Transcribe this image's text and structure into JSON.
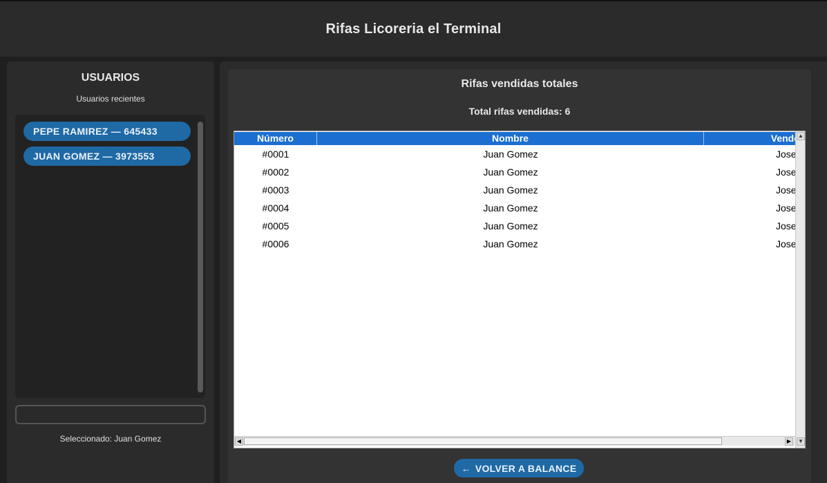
{
  "app": {
    "title": "Rifas Licoreria el Terminal"
  },
  "sidebar": {
    "title": "USUARIOS",
    "subtitle": "Usuarios recientes",
    "users": [
      {
        "name": "PEPE RAMIREZ",
        "id": "645433",
        "label": "PEPE RAMIREZ  —  645433"
      },
      {
        "name": "JUAN GOMEZ",
        "id": "3973553",
        "label": "JUAN GOMEZ  —  3973553"
      }
    ],
    "search_value": "",
    "selected_text": "Seleccionado: Juan Gomez"
  },
  "main": {
    "title": "Rifas vendidas totales",
    "total_text": "Total rifas vendidas: 6",
    "table": {
      "columns": [
        "Número",
        "Nombre",
        "Vende"
      ],
      "rows": [
        [
          "#0001",
          "Juan Gomez",
          "Jose"
        ],
        [
          "#0002",
          "Juan Gomez",
          "Jose"
        ],
        [
          "#0003",
          "Juan Gomez",
          "Jose"
        ],
        [
          "#0004",
          "Juan Gomez",
          "Jose"
        ],
        [
          "#0005",
          "Juan Gomez",
          "Jose"
        ],
        [
          "#0006",
          "Juan Gomez",
          "Jose"
        ]
      ]
    },
    "back_button": {
      "icon": "←",
      "label": "VOLVER A BALANCE"
    }
  },
  "colors": {
    "accent": "#1f69a5",
    "table_header": "#1b6fd0",
    "background": "#1f1f1f",
    "panel": "#2b2b2b"
  }
}
